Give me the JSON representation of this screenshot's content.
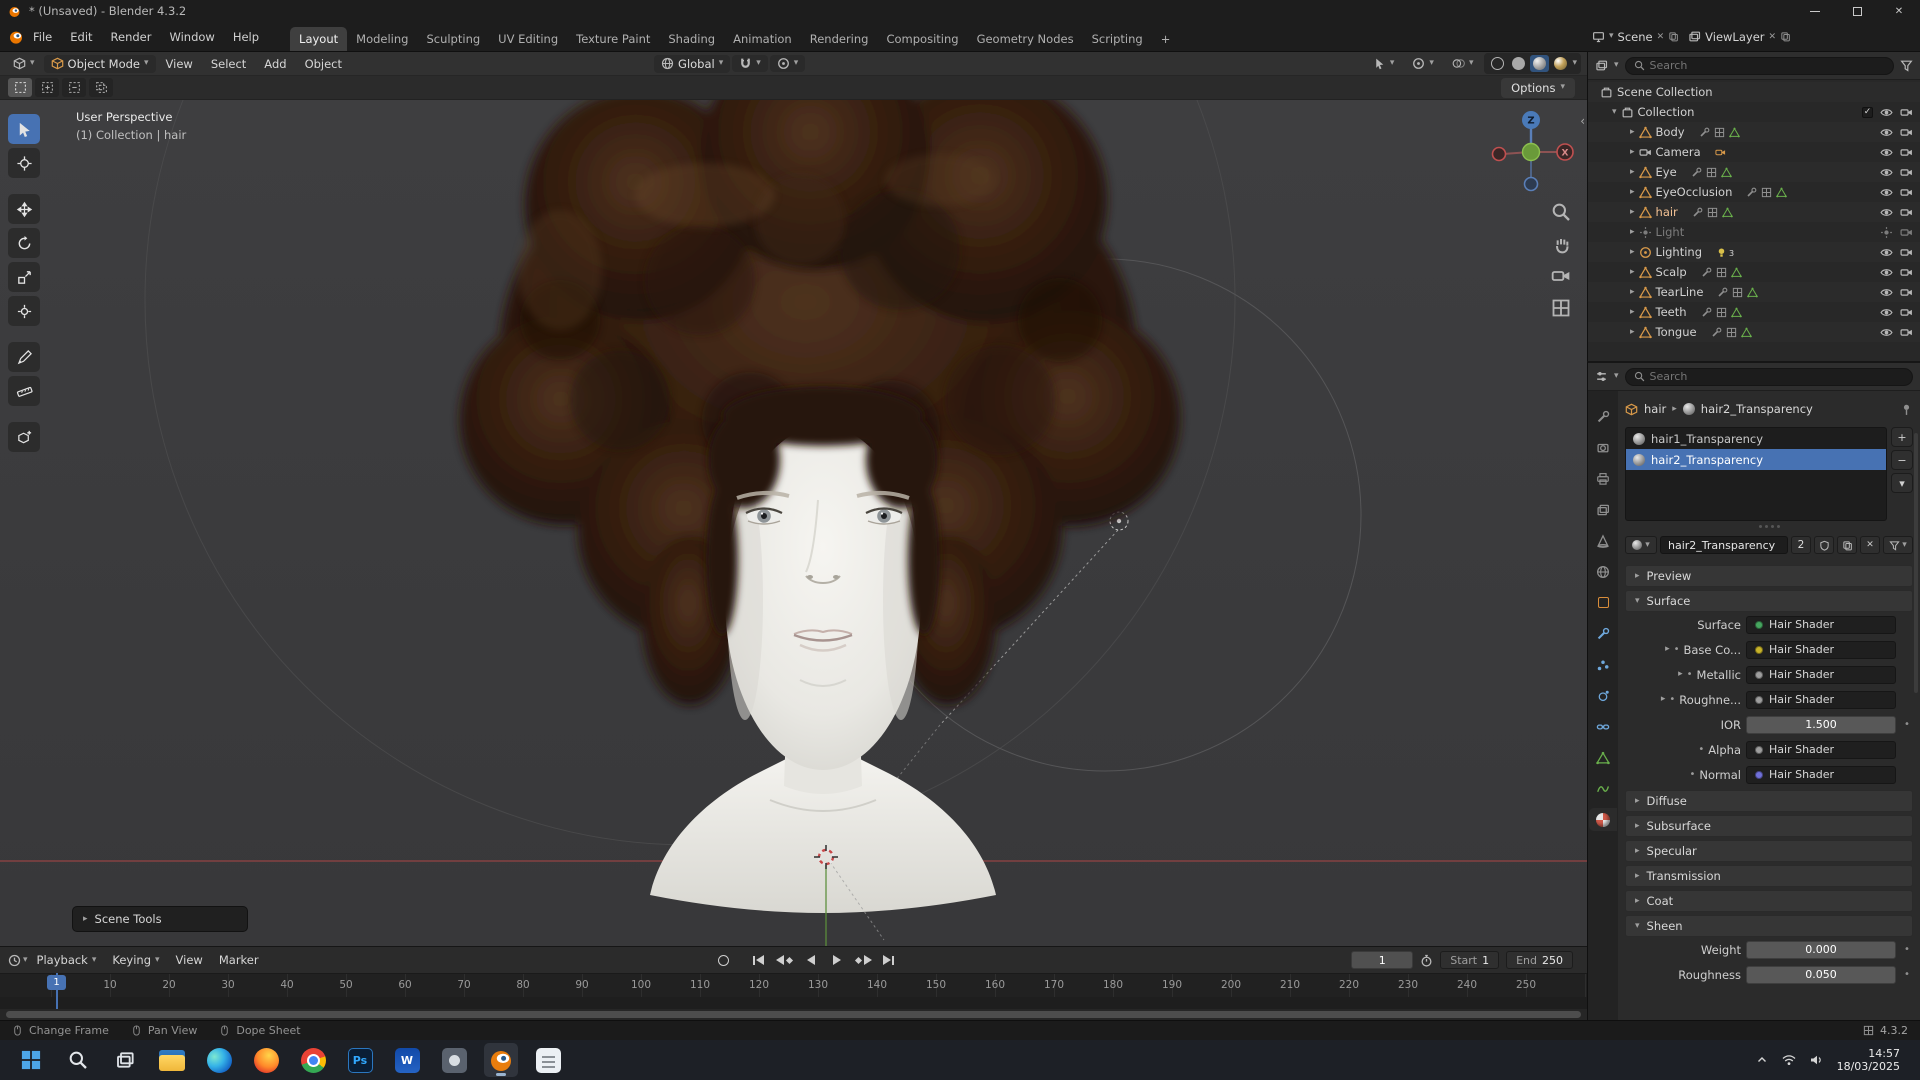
{
  "window": {
    "title": "* (Unsaved) - Blender 4.3.2"
  },
  "glyphs": {
    "chevron_right": "▸",
    "chevron_down": "▾",
    "plus": "+",
    "minus": "−",
    "close": "✕",
    "check": "✓",
    "dot": "•",
    "collapse": "‹"
  },
  "topbar": {
    "menus": {
      "file": "File",
      "edit": "Edit",
      "render": "Render",
      "window": "Window",
      "help": "Help"
    },
    "workspaces": [
      "Layout",
      "Modeling",
      "Sculpting",
      "UV Editing",
      "Texture Paint",
      "Shading",
      "Animation",
      "Rendering",
      "Compositing",
      "Geometry Nodes",
      "Scripting"
    ],
    "add_workspace": "+",
    "scene_label": "Scene",
    "viewlayer_label": "ViewLayer"
  },
  "viewport": {
    "mode": "Object Mode",
    "menus": {
      "view": "View",
      "select": "Select",
      "add": "Add",
      "object": "Object"
    },
    "orientation": "Global",
    "options": "Options",
    "overlay": {
      "perspective": "User Perspective",
      "collection": "(1) Collection | hair"
    },
    "scene_tools": "Scene Tools",
    "axis": {
      "z": "Z",
      "x": "X"
    }
  },
  "outliner": {
    "search_placeholder": "Search",
    "scene_collection": "Scene Collection",
    "collection": "Collection",
    "items": [
      {
        "label": "Body"
      },
      {
        "label": "Camera"
      },
      {
        "label": "Eye"
      },
      {
        "label": "EyeOcclusion"
      },
      {
        "label": "hair"
      },
      {
        "label": "Light"
      },
      {
        "label": "Lighting",
        "badge": "3"
      },
      {
        "label": "Scalp"
      },
      {
        "label": "TearLine"
      },
      {
        "label": "Teeth"
      },
      {
        "label": "Tongue"
      }
    ]
  },
  "properties": {
    "search_placeholder": "Search",
    "breadcrumb": {
      "object": "hair",
      "material": "hair2_Transparency"
    },
    "slots": [
      {
        "name": "hair1_Transparency"
      },
      {
        "name": "hair2_Transparency"
      }
    ],
    "datablock": {
      "name": "hair2_Transparency",
      "users": "2"
    },
    "preview_label": "Preview",
    "surface_label": "Surface",
    "rows": [
      {
        "label": "Surface",
        "value": "Hair Shader"
      },
      {
        "label": "Base Co...",
        "value": "Hair Shader"
      },
      {
        "label": "Metallic",
        "value": "Hair Shader"
      },
      {
        "label": "Roughne...",
        "value": "Hair Shader"
      },
      {
        "label": "IOR",
        "value": "1.500"
      },
      {
        "label": "Alpha",
        "value": "Hair Shader"
      },
      {
        "label": "Normal",
        "value": "Hair Shader"
      }
    ],
    "sections": [
      "Diffuse",
      "Subsurface",
      "Specular",
      "Transmission",
      "Coat",
      "Sheen"
    ],
    "sheen": {
      "weight_label": "Weight",
      "weight_value": "0.000",
      "roughness_label": "Roughness",
      "roughness_value": "0.050"
    }
  },
  "timeline": {
    "menus": {
      "playback": "Playback",
      "keying": "Keying",
      "view": "View",
      "marker": "Marker"
    },
    "current_frame": "1",
    "playhead_label": "1",
    "start_label": "Start",
    "start_value": "1",
    "end_label": "End",
    "end_value": "250",
    "ruler": [
      "10",
      "20",
      "30",
      "40",
      "50",
      "60",
      "70",
      "80",
      "90",
      "100",
      "110",
      "120",
      "130",
      "140",
      "150",
      "160",
      "170",
      "180",
      "190",
      "200",
      "210",
      "220",
      "230",
      "240",
      "250"
    ]
  },
  "statusbar": {
    "items": [
      "Change Frame",
      "Pan View",
      "Dope Sheet"
    ],
    "version": "4.3.2"
  },
  "taskbar": {
    "time": "14:57",
    "date": "18/03/2025",
    "photoshop_label": "Ps",
    "word_label": "W"
  },
  "colors": {
    "selection_blue": "#4772b3",
    "hair_brown": "#3a2314",
    "socket_shader_green": "#46a55f",
    "socket_color_yellow": "#c7b32a",
    "socket_value_gray": "#9e9e9e",
    "socket_vector_purple": "#7070d8",
    "axis_red": "#c05050",
    "axis_green": "#6a9a3a",
    "axis_blue": "#4a7ab8"
  }
}
